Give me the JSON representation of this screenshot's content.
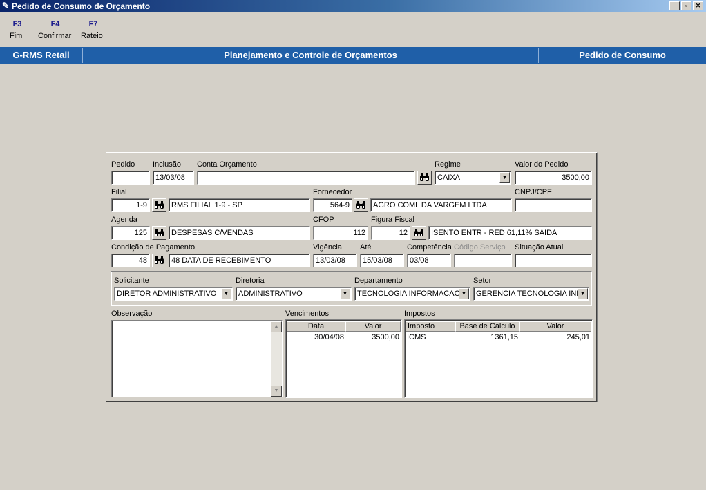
{
  "window": {
    "title": "Pedido de Consumo de Orçamento",
    "buttons": {
      "minimize": "_",
      "restore": "▫",
      "close": "✕"
    }
  },
  "toolbar": [
    {
      "key": "F3",
      "label": "Fim"
    },
    {
      "key": "F4",
      "label": "Confirmar"
    },
    {
      "key": "F7",
      "label": "Rateio"
    }
  ],
  "header": {
    "app": "G-RMS Retail",
    "module": "Planejamento e Controle de Orçamentos",
    "screen": "Pedido de Consumo"
  },
  "form": {
    "pedido": {
      "label": "Pedido",
      "value": ""
    },
    "inclusao": {
      "label": "Inclusão",
      "value": "13/03/08"
    },
    "conta_orcamento": {
      "label": "Conta Orçamento",
      "value": ""
    },
    "regime": {
      "label": "Regime",
      "value": "CAIXA"
    },
    "valor_pedido": {
      "label": "Valor do Pedido",
      "value": "3500,00"
    },
    "filial": {
      "label": "Filial",
      "code": "1-9",
      "name": "RMS FILIAL 1-9 - SP"
    },
    "fornecedor": {
      "label": "Fornecedor",
      "code": "564-9",
      "name": "AGRO COML DA VARGEM LTDA"
    },
    "cnpj": {
      "label": "CNPJ/CPF",
      "value": ""
    },
    "agenda": {
      "label": "Agenda",
      "code": "125",
      "name": "DESPESAS C/VENDAS"
    },
    "cfop": {
      "label": "CFOP",
      "value": "112"
    },
    "figura_fiscal": {
      "label": "Figura Fiscal",
      "code": "12",
      "name": "ISENTO ENTR - RED 61,11% SAIDA"
    },
    "condicao_pagamento": {
      "label": "Condição de Pagamento",
      "code": "48",
      "name": "48 DATA DE RECEBIMENTO"
    },
    "vigencia": {
      "label": "Vigência",
      "value": "13/03/08"
    },
    "ate": {
      "label": "Até",
      "value": "15/03/08"
    },
    "competencia": {
      "label": "Competência",
      "value": "03/08"
    },
    "codigo_servico": {
      "label": "Código Serviço",
      "value": ""
    },
    "situacao_atual": {
      "label": "Situação Atual",
      "value": ""
    },
    "solicitante": {
      "label": "Solicitante",
      "value": "DIRETOR ADMINISTRATIVO"
    },
    "diretoria": {
      "label": "Diretoria",
      "value": "ADMINISTRATIVO"
    },
    "departamento": {
      "label": "Departamento",
      "value": "TECNOLOGIA INFORMACAO"
    },
    "setor": {
      "label": "Setor",
      "value": "GERENCIA TECNOLOGIA INF"
    },
    "observacao": {
      "label": "Observação",
      "value": ""
    }
  },
  "vencimentos": {
    "label": "Vencimentos",
    "columns": [
      "Data",
      "Valor"
    ],
    "rows": [
      {
        "data": "30/04/08",
        "valor": "3500,00"
      }
    ]
  },
  "impostos": {
    "label": "Impostos",
    "columns": [
      "Imposto",
      "Base de Cálculo",
      "Valor"
    ],
    "rows": [
      {
        "imposto": "ICMS",
        "base": "1361,15",
        "valor": "245,01"
      }
    ]
  },
  "colors": {
    "titlebar_start": "#0a246a",
    "band": "#1f5fa8",
    "key": "#1a1a8c",
    "background": "#d4d0c8"
  },
  "icons": {
    "binoculars": "binoculars-icon",
    "dropdown": "chevron-down-icon"
  }
}
